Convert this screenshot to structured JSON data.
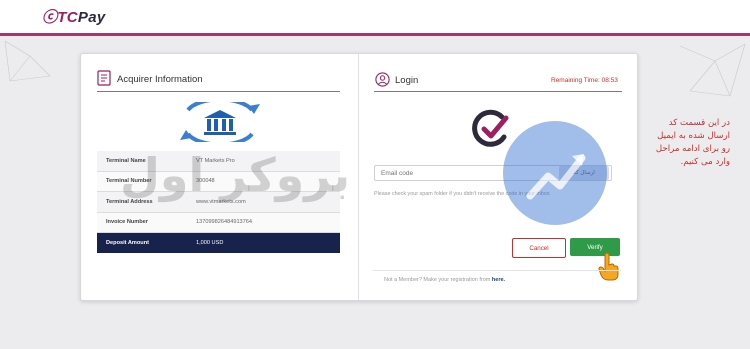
{
  "header": {
    "logo_tc": "ⓒTC",
    "logo_pay": "Pay",
    "accent_color": "#a3386d"
  },
  "acquirer": {
    "title": "Acquirer Information",
    "icon": "document-icon",
    "bank_icon": "bank-icon",
    "rows": [
      {
        "label": "Terminal Name",
        "value": "VT Markets Pro"
      },
      {
        "label": "Terminal Number",
        "value": "300048"
      },
      {
        "label": "Terminal Address",
        "value": "www.vtmarkets.com"
      },
      {
        "label": "Invoice Number",
        "value": "137099826484913764"
      }
    ],
    "deposit": {
      "label": "Deposit Amount",
      "value": "1,000 USD"
    }
  },
  "login": {
    "title": "Login",
    "icon": "user-icon",
    "remaining_time": "Remaining Time:  08:53",
    "email_placeholder": "Email code",
    "send_label": "ارسال کد",
    "hint": "Please check your spam folder if you didn't receive the code in your inbox.",
    "cancel_label": "Cancel",
    "verify_label": "Verify",
    "footer_prefix": "Not a Member? Make your registration from ",
    "footer_link": "here.",
    "danger_color": "#c0312f",
    "success_color": "#2f9b48"
  },
  "annotation": {
    "note": "در این قسمت کد ارسال شده به ایمیل رو برای ادامه مراحل وارد می کنیم."
  },
  "watermark": {
    "text": "بروکر اول"
  }
}
